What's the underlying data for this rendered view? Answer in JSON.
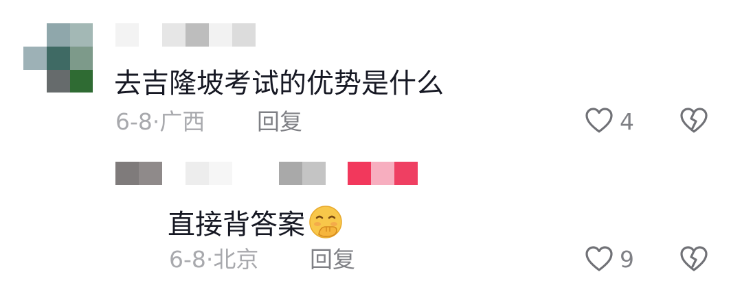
{
  "comments": [
    {
      "text": "去吉隆坡考试的优势是什么",
      "date": "6-8",
      "separator": "·",
      "location": "广西",
      "reply_label": "回复",
      "likes": "4",
      "like_icon": "heart-outline-icon",
      "dislike_icon": "broken-heart-icon"
    },
    {
      "text": "直接背答案",
      "emoji": "face-with-hand-over-mouth-emoji",
      "date": "6-8",
      "separator": "·",
      "location": "北京",
      "reply_label": "回复",
      "likes": "9",
      "like_icon": "heart-outline-icon",
      "dislike_icon": "broken-heart-icon"
    }
  ],
  "colors": {
    "text": "#161823",
    "meta": "#a8a9ad",
    "icon": "#707176",
    "emoji_face": "#f8c74a",
    "accent_pink": "#f2385c"
  }
}
